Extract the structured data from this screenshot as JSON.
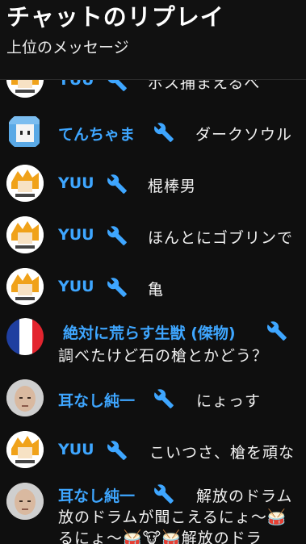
{
  "header": {
    "title": "チャットのリプレイ",
    "subtitle": "上位のメッセージ"
  },
  "messages": [
    {
      "author": "YUU",
      "text": "ボス捕まえるべ"
    },
    {
      "author": "てんちゃま",
      "text": "ダークソウル"
    },
    {
      "author": "YUU",
      "text": "棍棒男"
    },
    {
      "author": "YUU",
      "text": "ほんとにゴブリンで"
    },
    {
      "author": "YUU",
      "text": "亀"
    },
    {
      "author": "絶対に荒らす生獣 (傑物)",
      "text": "調べたけど石の槍とかどう？"
    },
    {
      "author": "耳なし純一",
      "text": "にょっす"
    },
    {
      "author": "YUU",
      "text": "こいつさ、槍を頑な"
    },
    {
      "author": "耳なし純一",
      "text": "解放のドラム",
      "text_line2": "放のドラムが聞こえるにょ～🥁",
      "text_line3": "るにょ～🥁🐮🥁解放のドラ"
    }
  ],
  "colors": {
    "background": "#0f0f0f",
    "author": "#3ea6ff",
    "text": "#f1f1f1"
  },
  "icons": [
    "wrench-icon",
    "avatar"
  ]
}
